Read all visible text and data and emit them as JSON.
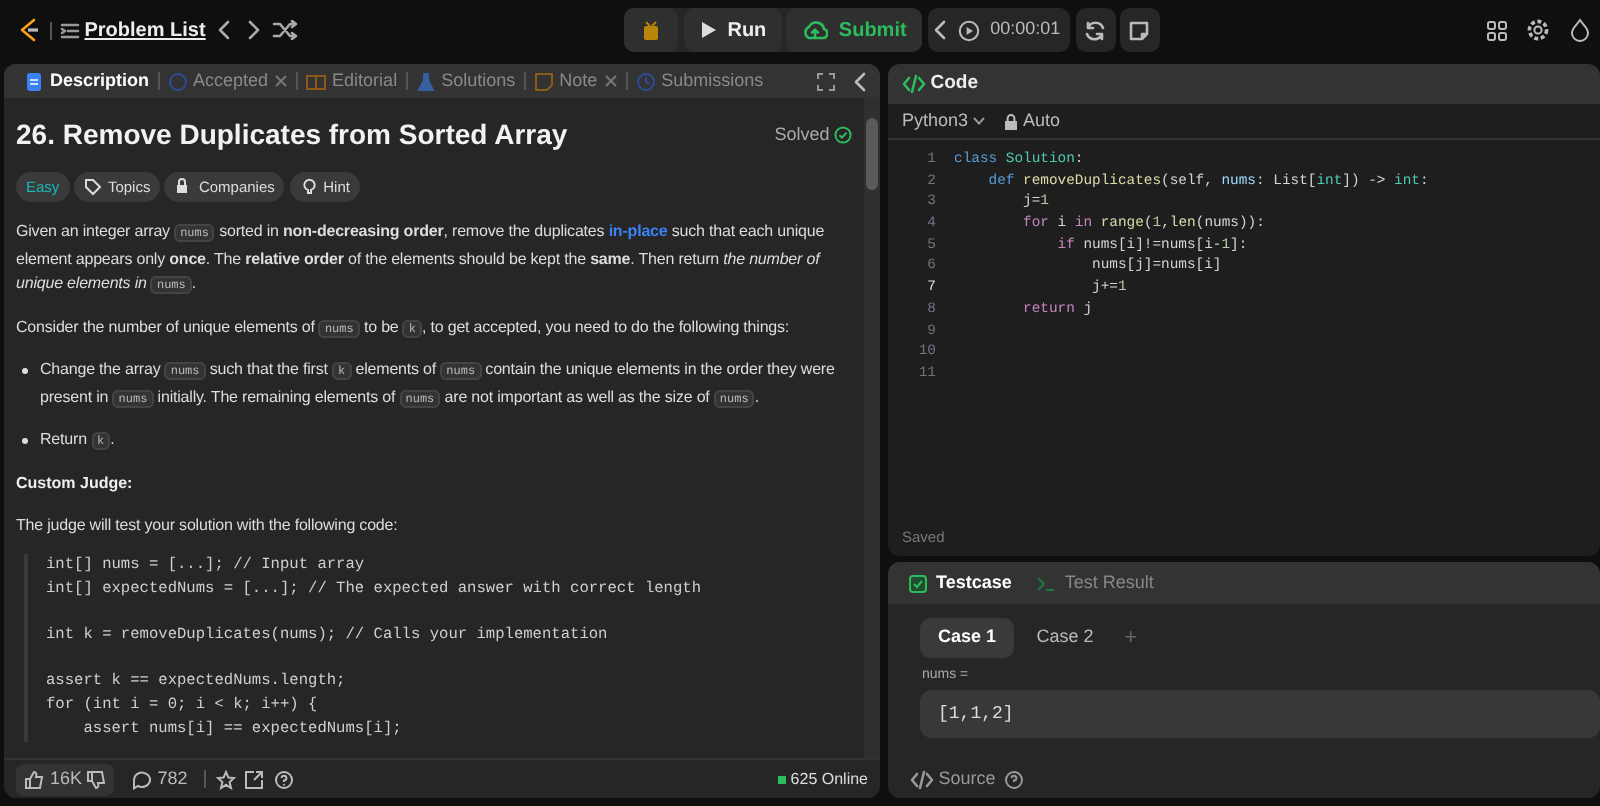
{
  "topbar": {
    "title": "Problem List",
    "run": "Run",
    "submit": "Submit",
    "timer": "00:00:01"
  },
  "tabs": [
    {
      "label": "Description",
      "selected": true,
      "closable": false,
      "kind": "description"
    },
    {
      "label": "Accepted",
      "selected": false,
      "closable": true,
      "kind": "accepted"
    },
    {
      "label": "Editorial",
      "selected": false,
      "closable": false,
      "kind": "editorial"
    },
    {
      "label": "Solutions",
      "selected": false,
      "closable": false,
      "kind": "solutions"
    },
    {
      "label": "Note",
      "selected": false,
      "closable": true,
      "kind": "note"
    },
    {
      "label": "Submissions",
      "selected": false,
      "closable": false,
      "kind": "submissions"
    }
  ],
  "problem": {
    "title": "26. Remove Duplicates from Sorted Array",
    "status": "Solved",
    "tags": [
      {
        "label": "Easy",
        "kind": "difficulty"
      },
      {
        "label": "Topics",
        "kind": "topics"
      },
      {
        "label": "Companies",
        "kind": "companies"
      },
      {
        "label": "Hint",
        "kind": "hint"
      }
    ],
    "paragraphs": [
      [
        {
          "kind": "text",
          "text": "Given an integer array "
        },
        {
          "kind": "code",
          "text": "nums"
        },
        {
          "kind": "text",
          "text": " sorted in **non-decreasing order**, remove the duplicates "
        },
        {
          "kind": "link",
          "text": "in-place"
        },
        {
          "kind": "text",
          "text": " such that each unique element appears only **once**. The **relative order** of the elements should be kept the **same**. Then return *the number of unique elements in* "
        },
        {
          "kind": "code",
          "text": "nums"
        },
        {
          "kind": "text",
          "text": "."
        }
      ],
      [
        {
          "kind": "text",
          "text": "Consider the number of unique elements of "
        },
        {
          "kind": "code",
          "text": "nums"
        },
        {
          "kind": "text",
          "text": " to be "
        },
        {
          "kind": "code",
          "text": "k"
        },
        {
          "kind": "text",
          "text": ", to get accepted, you need to do the following things:"
        }
      ]
    ],
    "bullets": [
      [
        {
          "kind": "text",
          "text": "Change the array "
        },
        {
          "kind": "code",
          "text": "nums"
        },
        {
          "kind": "text",
          "text": " such that the first "
        },
        {
          "kind": "code",
          "text": "k"
        },
        {
          "kind": "text",
          "text": " elements of "
        },
        {
          "kind": "code",
          "text": "nums"
        },
        {
          "kind": "text",
          "text": " contain the unique elements in the order they were present in "
        },
        {
          "kind": "code",
          "text": "nums"
        },
        {
          "kind": "text",
          "text": " initially. The remaining elements of "
        },
        {
          "kind": "code",
          "text": "nums"
        },
        {
          "kind": "text",
          "text": " are not important as well as the size of "
        },
        {
          "kind": "code",
          "text": "nums"
        },
        {
          "kind": "text",
          "text": "."
        }
      ],
      [
        {
          "kind": "text",
          "text": "Return "
        },
        {
          "kind": "code",
          "text": "k"
        },
        {
          "kind": "text",
          "text": "."
        }
      ]
    ],
    "heading": "Custom Judge:",
    "judge_intro": "The judge will test your solution with the following code:",
    "judge_code": [
      [
        "int[] nums = [...]; // Input array",
        "int[] expectedNums = [...]; // The expected answer with correct length"
      ],
      [
        "int k = removeDuplicates(nums); // Calls your implementation"
      ],
      [
        "assert k == expectedNums.length;",
        "for (int i = 0; i < k; i++) {",
        "    assert nums[i] == expectedNums[i];"
      ]
    ]
  },
  "footer": {
    "likes": "16K",
    "comments": "782",
    "online": "625 Online"
  },
  "code_panel": {
    "title": "Code",
    "language": "Python3",
    "mode": "Auto",
    "saved": "Saved",
    "lines": [
      {
        "number": "1",
        "current": false,
        "tokens": [
          {
            "kind": "kw",
            "text": "class"
          },
          {
            "kind": "type",
            "text": " Solution"
          },
          {
            "kind": "plain",
            "text": ":"
          }
        ]
      },
      {
        "number": "2",
        "current": false,
        "tokens": [
          {
            "kind": "kw",
            "text": "    def"
          },
          {
            "kind": "fn",
            "text": " removeDuplicates"
          },
          {
            "kind": "plain",
            "text": "(self, "
          },
          {
            "kind": "var",
            "text": "nums"
          },
          {
            "kind": "plain",
            "text": ": List["
          },
          {
            "kind": "type",
            "text": "int"
          },
          {
            "kind": "plain",
            "text": "]) -> "
          },
          {
            "kind": "type",
            "text": "int"
          },
          {
            "kind": "plain",
            "text": ":"
          }
        ]
      },
      {
        "number": "3",
        "current": false,
        "tokens": [
          {
            "kind": "plain",
            "text": "        j="
          },
          {
            "kind": "num",
            "text": "1"
          }
        ]
      },
      {
        "number": "4",
        "current": false,
        "tokens": [
          {
            "kind": "ctrl",
            "text": "        for"
          },
          {
            "kind": "plain",
            "text": " i "
          },
          {
            "kind": "ctrl",
            "text": "in"
          },
          {
            "kind": "fn",
            "text": " range"
          },
          {
            "kind": "plain",
            "text": "("
          },
          {
            "kind": "num",
            "text": "1"
          },
          {
            "kind": "plain",
            "text": ","
          },
          {
            "kind": "fn",
            "text": "len"
          },
          {
            "kind": "plain",
            "text": "(nums)):"
          }
        ]
      },
      {
        "number": "5",
        "current": false,
        "tokens": [
          {
            "kind": "ctrl",
            "text": "            if"
          },
          {
            "kind": "plain",
            "text": " nums[i]!=nums[i-"
          },
          {
            "kind": "num",
            "text": "1"
          },
          {
            "kind": "plain",
            "text": "]:"
          }
        ]
      },
      {
        "number": "6",
        "current": false,
        "tokens": [
          {
            "kind": "plain",
            "text": "                nums[j]=nums[i]"
          }
        ]
      },
      {
        "number": "7",
        "current": true,
        "tokens": [
          {
            "kind": "plain",
            "text": "                j+="
          },
          {
            "kind": "num",
            "text": "1"
          }
        ]
      },
      {
        "number": "8",
        "current": false,
        "tokens": [
          {
            "kind": "ctrl",
            "text": "        return"
          },
          {
            "kind": "plain",
            "text": " j"
          }
        ]
      },
      {
        "number": "9",
        "current": false
      },
      {
        "number": "10",
        "current": false
      },
      {
        "number": "11",
        "current": false
      }
    ]
  },
  "test_panel": {
    "tabs": [
      {
        "label": "Testcase",
        "selected": true,
        "kind": "testcase"
      },
      {
        "label": "Test Result",
        "selected": false,
        "kind": "result"
      }
    ],
    "cases": [
      {
        "label": "Case 1",
        "selected": true
      },
      {
        "label": "Case 2",
        "selected": false
      }
    ],
    "add": "+",
    "input_label": "nums =",
    "input_value": "[1,1,2]",
    "source": "Source"
  }
}
